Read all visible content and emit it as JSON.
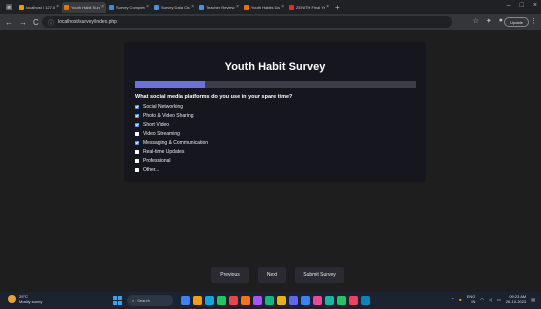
{
  "browser": {
    "tabs": [
      {
        "label": "localhost / 127.0.0.1 /",
        "color": "#f29900",
        "active": false
      },
      {
        "label": "Youth Habit Survey",
        "color": "#e37400",
        "active": true
      },
      {
        "label": "Survey Completed",
        "color": "#3c8dd9",
        "active": false
      },
      {
        "label": "Survey Data Charts",
        "color": "#4a90e2",
        "active": false
      },
      {
        "label": "Teacher Review",
        "color": "#4a90e2",
        "active": false
      },
      {
        "label": "Youth Habits Dashboard",
        "color": "#e37400",
        "active": false
      },
      {
        "label": "ZENITH Final Year CS",
        "color": "#d93025",
        "active": false
      }
    ],
    "new_tab": "+",
    "window_controls": [
      "–",
      "□",
      "×"
    ],
    "nav": {
      "back": "←",
      "forward": "→",
      "reload": "C"
    },
    "url": "localhost/survey/index.php",
    "update_label": "Update",
    "menu": "⋮"
  },
  "survey": {
    "title": "Youth Habit Survey",
    "progress": 0.25,
    "accent": "#6a72d8",
    "question": "What social media platforms do you use in your spare time?",
    "options": [
      {
        "label": "Social Networking",
        "checked": true
      },
      {
        "label": "Photo & Video Sharing",
        "checked": true
      },
      {
        "label": "Short Video",
        "checked": true
      },
      {
        "label": "Video Streaming",
        "checked": false
      },
      {
        "label": "Messaging & Communication",
        "checked": true
      },
      {
        "label": "Real-time Updates",
        "checked": false
      },
      {
        "label": "Professional",
        "checked": false
      },
      {
        "label": "Other...",
        "checked": false
      }
    ],
    "buttons": {
      "previous": "Previous",
      "next": "Next",
      "submit": "Submit Survey"
    }
  },
  "taskbar": {
    "weather_temp": "29°C",
    "weather_desc": "Mostly sunny",
    "search_placeholder": "Search",
    "app_colors": [
      "#3b82f6",
      "#f59e0b",
      "#0ea5e9",
      "#22c55e",
      "#ef4444",
      "#f97316",
      "#a855f7",
      "#10b981",
      "#eab308",
      "#6366f1",
      "#3b82f6",
      "#ec4899",
      "#14b8a6",
      "#22c55e",
      "#f43f5e",
      "#0284c7"
    ],
    "lang": "ENG",
    "lang_region": "IN",
    "time": "09:23 AM",
    "date": "26-10-2023"
  }
}
